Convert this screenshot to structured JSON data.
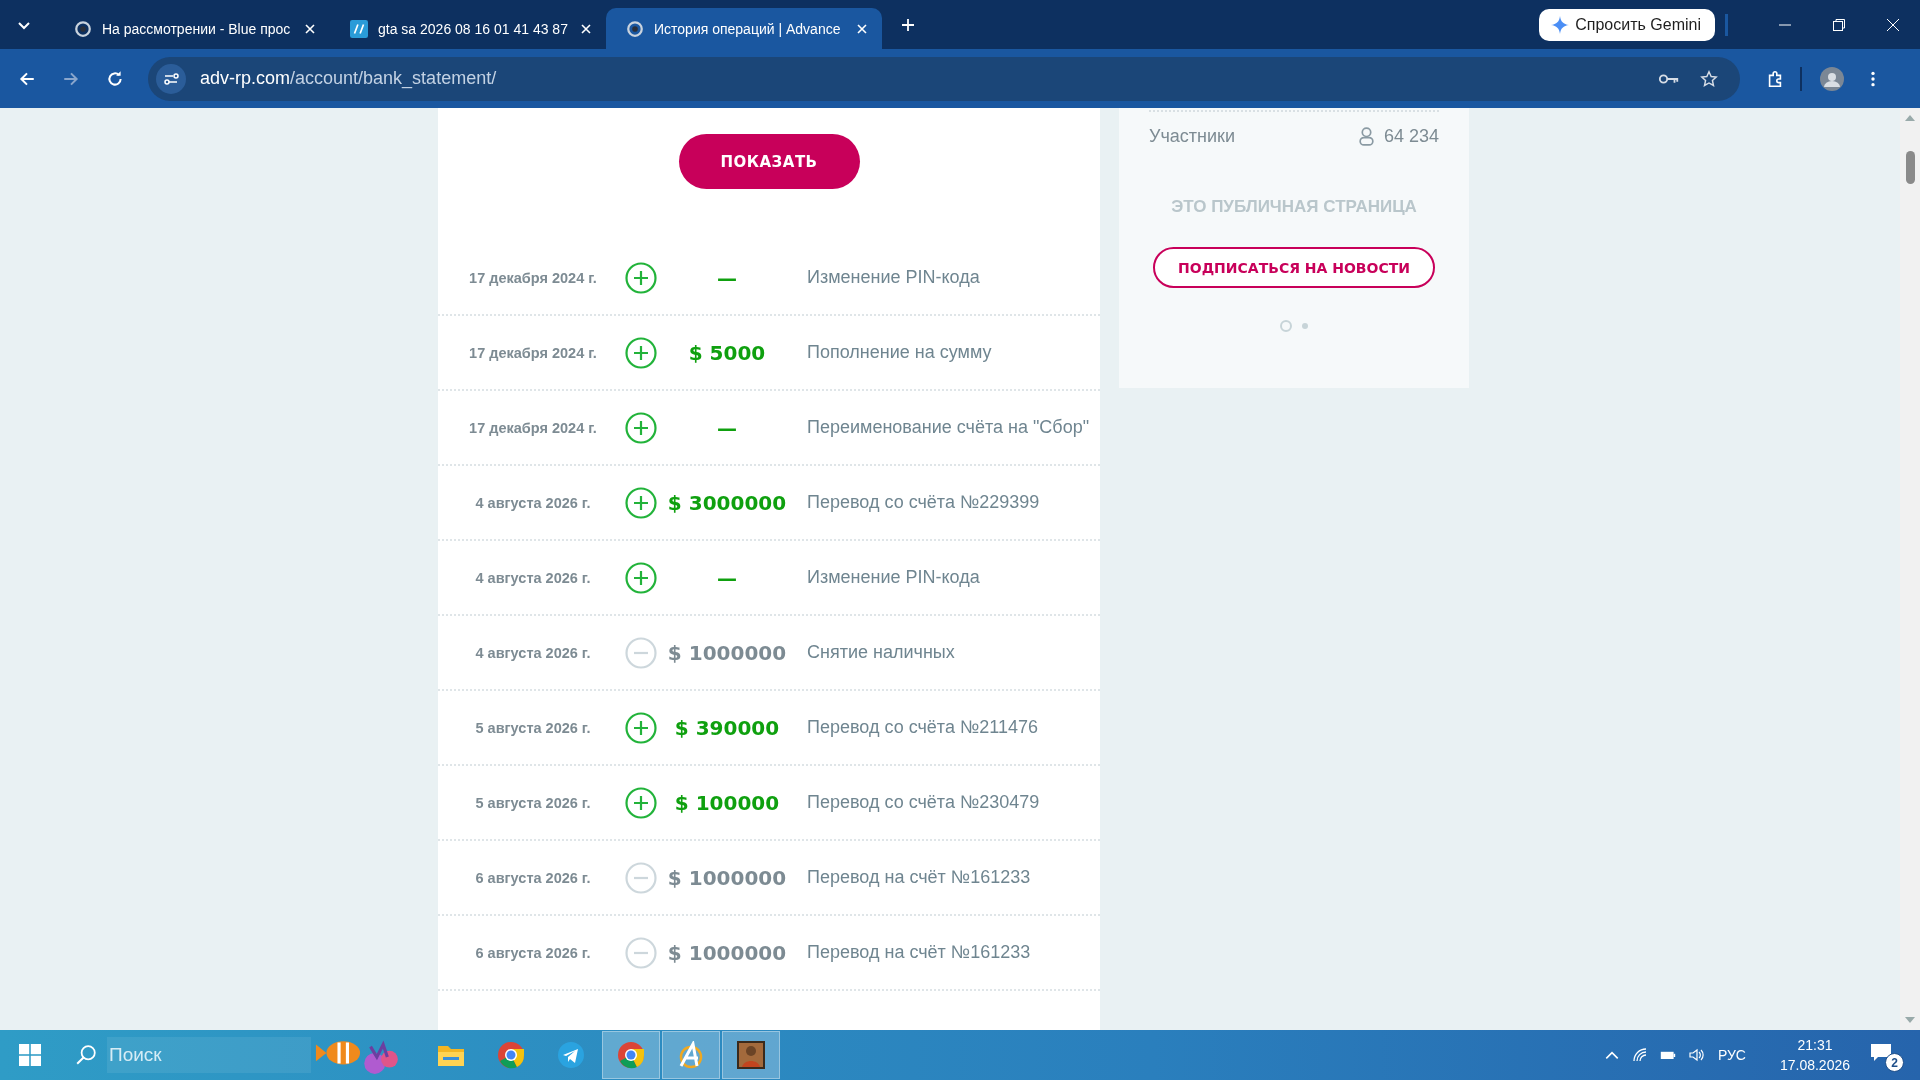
{
  "browser": {
    "tabs": [
      {
        "title": "На рассмотрении - Blue прос",
        "selected": false,
        "kind": "site"
      },
      {
        "title": "gta sa 2026 08 16 01 41 43 87",
        "selected": false,
        "kind": "image"
      },
      {
        "title": "История операций | Advance",
        "selected": true,
        "kind": "site"
      }
    ],
    "gemini_button": "Спросить Gemini",
    "address": {
      "host": "adv-rp.com",
      "path": "/account/bank_statement/"
    }
  },
  "statement": {
    "show_button": "ПОКАЗАТЬ",
    "rows": [
      {
        "date": "17 декабря 2024 г.",
        "kind": "in",
        "amount": "—",
        "description": "Изменение PIN-кода"
      },
      {
        "date": "17 декабря 2024 г.",
        "kind": "in",
        "amount": "$ 5000",
        "description": "Пополнение на сумму"
      },
      {
        "date": "17 декабря 2024 г.",
        "kind": "in",
        "amount": "—",
        "description": "Переименование счёта на \"Сбор\""
      },
      {
        "date": "4 августа 2026 г.",
        "kind": "in",
        "amount": "$ 3000000",
        "description": "Перевод со счёта №229399"
      },
      {
        "date": "4 августа 2026 г.",
        "kind": "in",
        "amount": "—",
        "description": "Изменение PIN-кода"
      },
      {
        "date": "4 августа 2026 г.",
        "kind": "out",
        "amount": "$ 1000000",
        "description": "Снятие наличных"
      },
      {
        "date": "5 августа 2026 г.",
        "kind": "in",
        "amount": "$ 390000",
        "description": "Перевод со счёта №211476"
      },
      {
        "date": "5 августа 2026 г.",
        "kind": "in",
        "amount": "$ 100000",
        "description": "Перевод со счёта №230479"
      },
      {
        "date": "6 августа 2026 г.",
        "kind": "out",
        "amount": "$ 1000000",
        "description": "Перевод на счёт №161233"
      },
      {
        "date": "6 августа 2026 г.",
        "kind": "out",
        "amount": "$ 1000000",
        "description": "Перевод на счёт №161233"
      }
    ]
  },
  "side_panel": {
    "members_label": "Участники",
    "members_count": "64 234",
    "public_notice": "ЭТО ПУБЛИЧНАЯ СТРАНИЦА",
    "subscribe_button": "ПОДПИСАТЬСЯ НА НОВОСТИ",
    "dots": [
      {
        "selected": true
      },
      {
        "selected": false
      }
    ]
  },
  "taskbar": {
    "search_placeholder": "Поиск",
    "apps": [
      {
        "kind": "folder",
        "selected": false
      },
      {
        "kind": "chrome",
        "selected": false
      },
      {
        "kind": "telegram",
        "selected": false
      },
      {
        "kind": "chrome",
        "selected": true
      },
      {
        "kind": "launcher",
        "selected": true
      },
      {
        "kind": "game",
        "selected": true
      }
    ],
    "language": "РУС",
    "time": "21:31",
    "date": "17.08.2026",
    "notifications": "2"
  }
}
